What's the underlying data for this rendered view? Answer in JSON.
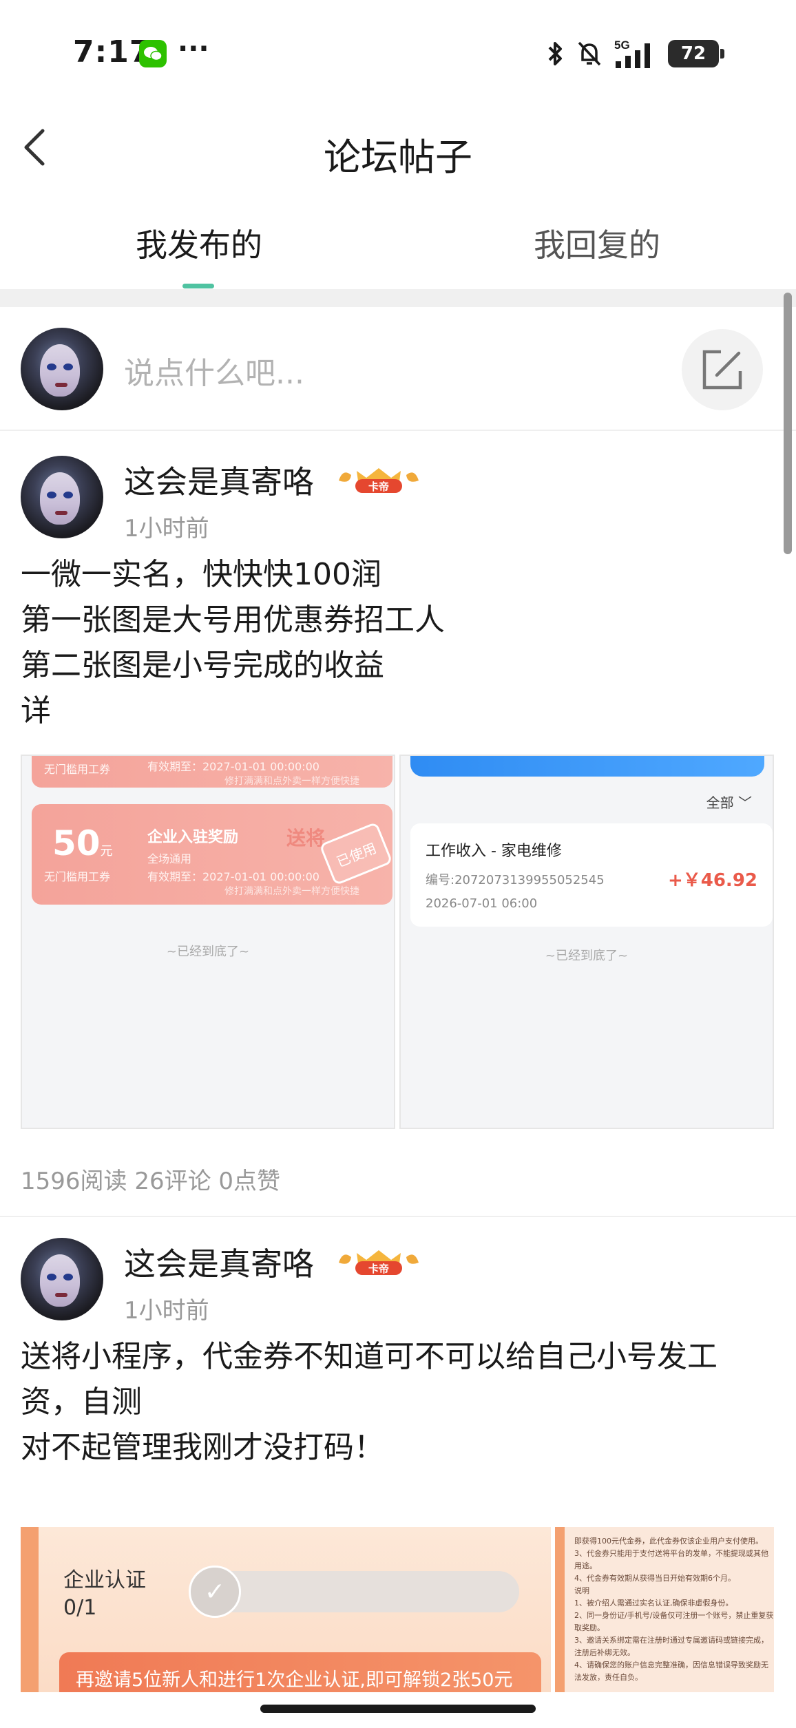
{
  "status_bar": {
    "time": "7:17",
    "battery": "72",
    "signal_label": "5G"
  },
  "nav": {
    "title": "论坛帖子"
  },
  "tabs": [
    {
      "label": "我发布的",
      "active": true
    },
    {
      "label": "我回复的",
      "active": false
    }
  ],
  "composer": {
    "placeholder": "说点什么吧..."
  },
  "posts": [
    {
      "author": "这会是真寄咯",
      "badge": "卡帝",
      "time": "1小时前",
      "body_lines": [
        "一微一实名，快快快100润",
        "第一张图是大号用优惠券招工人",
        "第二张图是小号完成的收益",
        "详"
      ],
      "stats": "1596阅读 26评论 0点赞",
      "image_left": {
        "coupon_top": {
          "small_label": "无门槛用工券",
          "valid": "有效期至：2027-01-01 00:00:00",
          "tip": "修打满满和点外卖一样方便快捷"
        },
        "coupon": {
          "amount": "50",
          "unit": "元",
          "small_label": "无门槛用工券",
          "title": "企业入驻奖励",
          "scope": "全场通用",
          "valid": "有效期至：2027-01-01 00:00:00",
          "tip": "修打满满和点外卖一样方便快捷",
          "watermark": "送将",
          "stamp": "已使用"
        },
        "end_note": "~已经到底了~"
      },
      "image_right": {
        "filter": "全部",
        "income_title": "工作收入 - 家电维修",
        "income_no": "编号:2072073139955052545",
        "income_date": "2026-07-01 06:00",
        "income_amount": "+￥46.92",
        "end_note": "~已经到底了~"
      }
    },
    {
      "author": "这会是真寄咯",
      "badge": "卡帝",
      "time": "1小时前",
      "body_lines": [
        "送将小程序，代金券不知道可不可以给自己小号发工",
        "资，自测",
        "对不起管理我刚才没打码！"
      ],
      "image_left": {
        "label": "企业认证",
        "count": "0/1",
        "invite": "再邀请5位新人和进行1次企业认证,即可解锁2张50元"
      },
      "image_right": {
        "rules": "即获得100元代金券，此代金券仅该企业用户支付使用。\n3、代金券只能用于支付送将平台的发单，不能提现或其他用途。\n4、代金券有效期从获得当日开始有效期6个月。\n说明\n1、被介绍人需通过实名认证,确保非虚假身份。\n2、同一身份证/手机号/设备仅可注册一个账号，禁止重复获取奖励。\n3、邀请关系绑定需在注册时通过专属邀请码或链接完成，注册后补绑无效。\n4、请确保您的账户信息完整准确，因信息错误导致奖励无法发放，责任自负。"
      }
    }
  ]
}
